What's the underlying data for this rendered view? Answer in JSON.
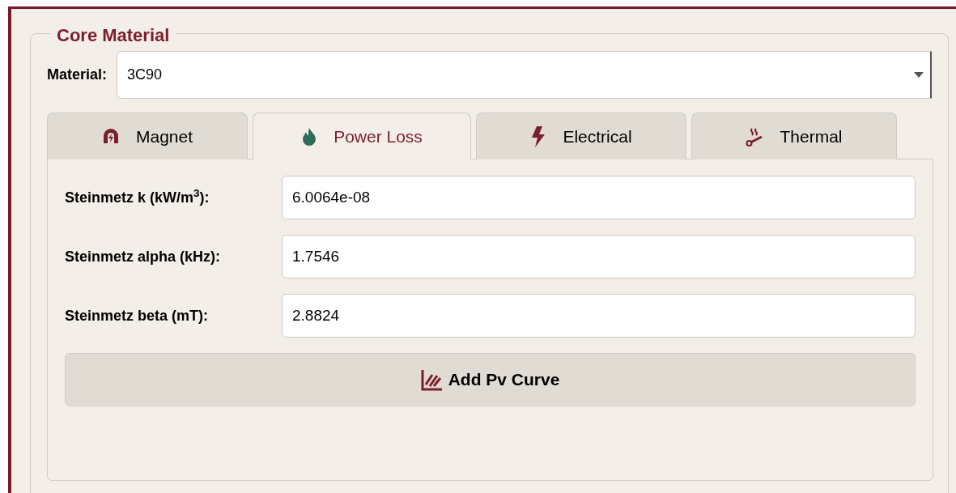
{
  "group": {
    "title": "Core Material"
  },
  "material": {
    "label": "Material:",
    "value": "3C90"
  },
  "tabs": [
    {
      "label": "Magnet",
      "kind": "magnet",
      "selected": false
    },
    {
      "label": "Power Loss",
      "kind": "flame",
      "selected": true
    },
    {
      "label": "Electrical",
      "kind": "bolt",
      "selected": false
    },
    {
      "label": "Thermal",
      "kind": "heat",
      "selected": false
    }
  ],
  "fields": [
    {
      "label": "Steinmetz k (kW/m$^{3}$):",
      "value": "6.0064e-08"
    },
    {
      "label": "Steinmetz alpha (kHz):",
      "value": "1.7546"
    },
    {
      "label": "Steinmetz beta (mT):",
      "value": "2.8824"
    }
  ],
  "button": {
    "label": "Add Pv Curve"
  }
}
